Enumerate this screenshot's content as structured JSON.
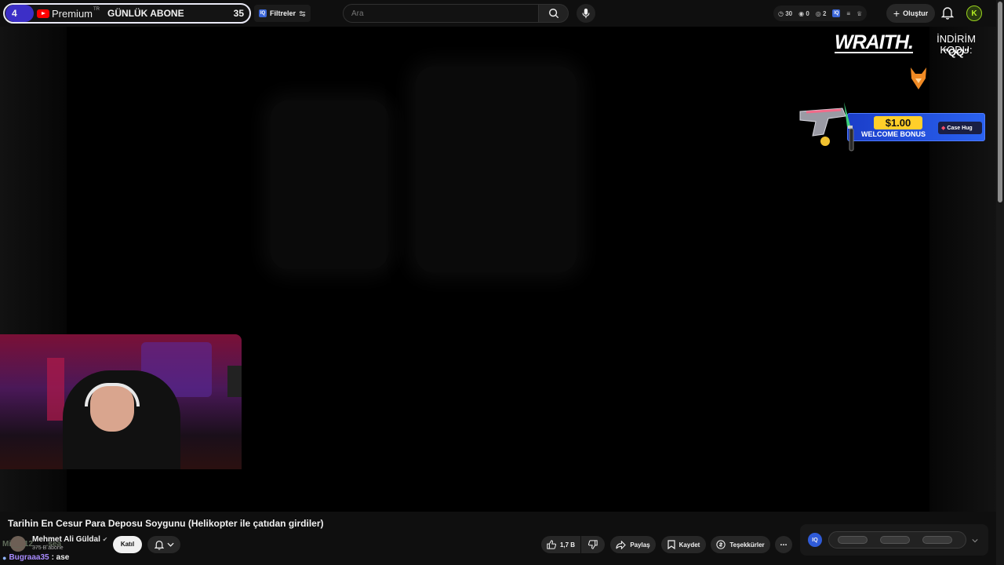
{
  "top_bar": {
    "sub_counter": {
      "left_value": "4",
      "brand": "Premium",
      "brand_sup": "TR",
      "title": "GÜNLÜK ABONE",
      "right_value": "35"
    },
    "filters_label": "Filtreler",
    "search": {
      "placeholder": "Ara"
    },
    "stats": {
      "views": "30",
      "eye": "0",
      "other": "2"
    },
    "create_label": "Oluştur",
    "avatar_letter": "K"
  },
  "overlay": {
    "sponsor_brand": "WRAITH.",
    "discount_label": "İNDİRİM KODU:",
    "discount_code": "\"QQ\"",
    "banner_price": "$1.00",
    "banner_text": "WELCOME BONUS",
    "banner_brand": "Case Hug"
  },
  "video_info": {
    "title": "Tarihin En Cesur Para Deposu Soygunu (Helikopter ile çatıdan girdiler)",
    "channel_name": "Mehmet Ali Güldal",
    "subscribers": "375 B abone",
    "join_label": "Katıl",
    "like_count": "1,7 B",
    "share_label": "Paylaş",
    "save_label": "Kaydet",
    "thanks_label": "Teşekkürler",
    "more_label": "..."
  },
  "extension": {
    "badge": "IQ"
  },
  "chat": {
    "overlay_name": "Mi___12___.sea",
    "message_user": "Bugraaa35",
    "message_text": ": ase"
  },
  "colors": {
    "accent": "#3c2fc7",
    "youtube_red": "#ff0000",
    "avatar_green": "#99d21e",
    "banner_blue": "#2a62f0",
    "banner_gold": "#ffcf2a"
  }
}
